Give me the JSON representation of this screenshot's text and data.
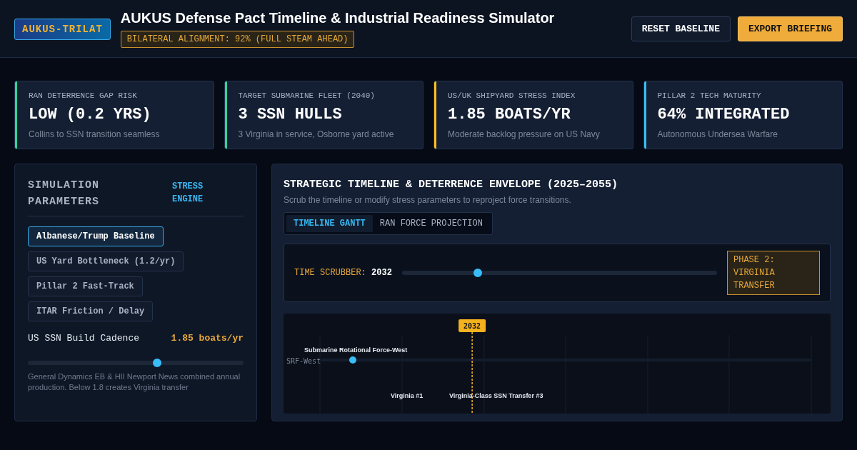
{
  "header": {
    "logo": "AUKUS-TRILAT",
    "title": "AUKUS Defense Pact Timeline & Industrial Readiness Simulator",
    "alignment_badge": "BILATERAL ALIGNMENT: 92% (FULL STEAM AHEAD)",
    "buttons": [
      {
        "label": "RESET BASELINE",
        "kind": "secondary"
      },
      {
        "label": "EXPORT BRIEFING",
        "kind": "primary"
      }
    ]
  },
  "kpis": [
    {
      "label": "RAN DETERRENCE GAP RISK",
      "value": "LOW (0.2 YRS)",
      "note": "Collins to SSN transition seamless",
      "color": "#34d399"
    },
    {
      "label": "TARGET SUBMARINE FLEET (2040)",
      "value": "3 SSN HULLS",
      "note": "3 Virginia in service, Osborne yard active",
      "color": "#34d399"
    },
    {
      "label": "US/UK SHIPYARD STRESS INDEX",
      "value": "1.85 BOATS/YR",
      "note": "Moderate backlog pressure on US Navy",
      "color": "#fbbf24"
    },
    {
      "label": "PILLAR 2 TECH MATURITY",
      "value": "64% INTEGRATED",
      "note": "Autonomous Undersea Warfare",
      "color": "#38bdf8"
    }
  ],
  "parameters": {
    "title": "SIMULATION PARAMETERS",
    "tag": "STRESS ENGINE",
    "scenarios": [
      {
        "label": "Albanese/Trump Baseline",
        "selected": true
      },
      {
        "label": "US Yard Bottleneck (1.2/yr)",
        "selected": false
      },
      {
        "label": "Pillar 2 Fast-Track",
        "selected": false
      },
      {
        "label": "ITAR Friction / Delay",
        "selected": false
      }
    ],
    "slider": {
      "label": "US SSN Build Cadence",
      "reading": "1.85 boats/yr",
      "level": 0.6
    },
    "description": "General Dynamics EB & HII Newport News combined annual production. Below 1.8 creates Virginia transfer"
  },
  "timeline": {
    "title": "STRATEGIC TIMELINE & DETERRENCE ENVELOPE (2025–2055)",
    "subtitle": "Scrub the timeline or modify stress parameters to reproject force transitions.",
    "tabs": [
      {
        "label": "TIMELINE GANTT",
        "selected": true
      },
      {
        "label": "RAN FORCE PROJECTION",
        "selected": false
      }
    ],
    "scrubber": {
      "label": "TIME SCRUBBER:",
      "year": "2032",
      "level": 0.24
    },
    "phase": "PHASE 2: VIRGINIA TRANSFER",
    "marker": "2032",
    "rows": [
      {
        "label": "SRF-West",
        "event": "Submarine Rotational Force-West"
      }
    ],
    "lower_labels": [
      "Virginia #1",
      "Virginia-Class SSN Transfer #3"
    ]
  }
}
